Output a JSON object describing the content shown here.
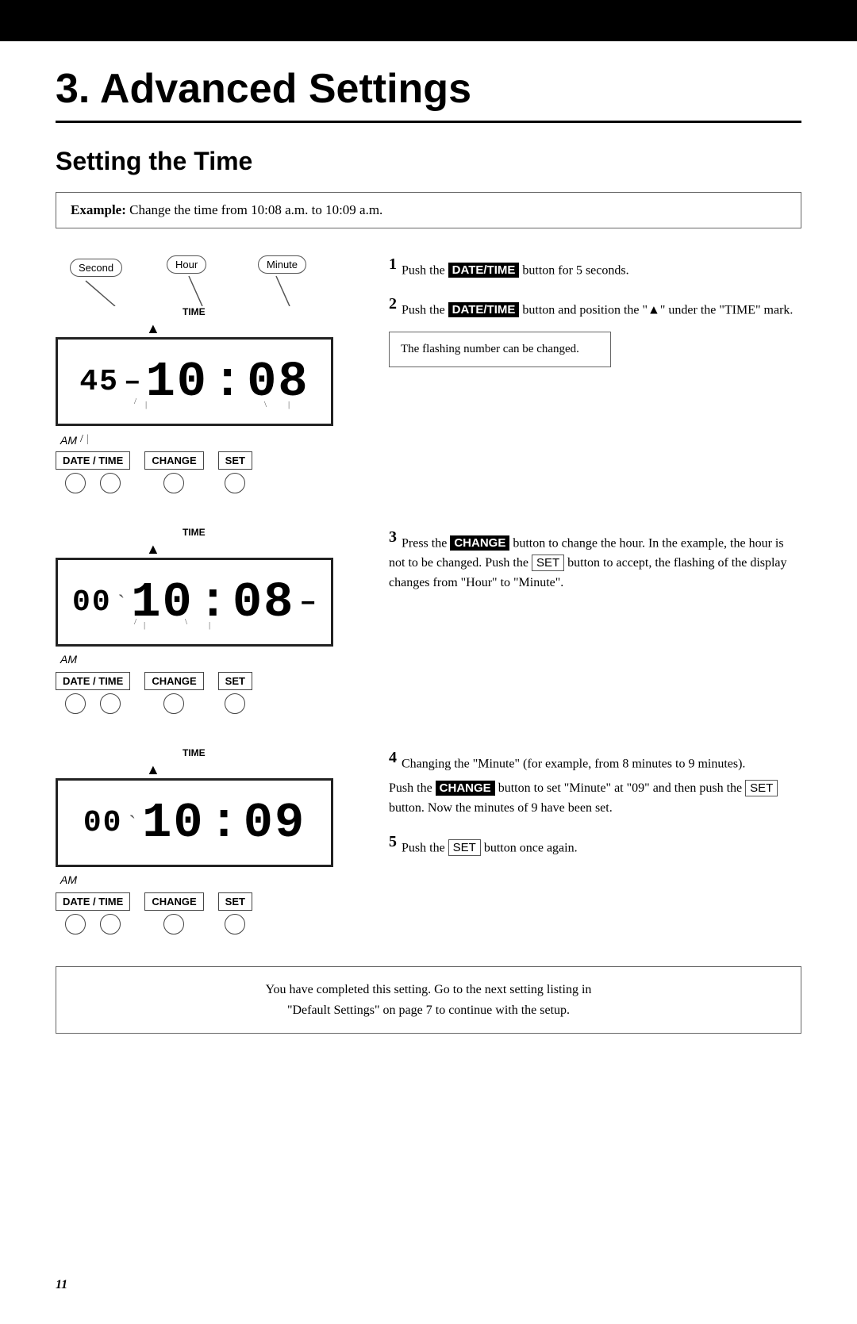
{
  "blackbar": "",
  "chapter": {
    "title": "3. Advanced Settings",
    "section": "Setting the Time",
    "example": {
      "label": "Example:",
      "text": "Change the time from 10:08 a.m. to 10:09 a.m."
    }
  },
  "clock1": {
    "time_label": "TIME",
    "seconds": "45",
    "dash": "–",
    "hours": "10",
    "colon": ":",
    "minutes": "08",
    "am": "AM",
    "slash": "/",
    "arrow_label": "▲",
    "balloons": {
      "second": "Second",
      "hour": "Hour",
      "minute": "Minute"
    },
    "buttons": {
      "date_time": "DATE / TIME",
      "change": "CHANGE",
      "set": "SET"
    }
  },
  "clock2": {
    "time_label": "TIME",
    "seconds": "00",
    "hours": "10",
    "colon": ":",
    "minutes": "08",
    "dash": "–",
    "am": "AM",
    "buttons": {
      "date_time": "DATE / TIME",
      "change": "CHANGE",
      "set": "SET"
    }
  },
  "clock3": {
    "time_label": "TIME",
    "seconds": "00",
    "hours": "10",
    "colon": ":",
    "minutes": "09",
    "am": "AM",
    "buttons": {
      "date_time": "DATE / TIME",
      "change": "CHANGE",
      "set": "SET"
    }
  },
  "steps": {
    "step1": {
      "num": "1",
      "text_before": "Push the ",
      "highlight": "DATE/TIME",
      "text_after": " button for 5 seconds."
    },
    "step2": {
      "num": "2",
      "text_before": "Push the ",
      "highlight": "DATE/TIME",
      "text_after": " button and position the \"▲\" under the \"TIME\" mark.",
      "note": "The flashing number can be changed."
    },
    "step3": {
      "num": "3",
      "text_before": "Press the ",
      "highlight": "CHANGE",
      "text_after1": " button to change the hour.  In the example, the hour is not to be changed. Push the ",
      "highlight2": "SET",
      "text_after2": " button to accept, the flashing of the display changes from \"Hour\" to \"Minute\"."
    },
    "step4": {
      "num": "4",
      "text_part1": "Changing the \"Minute\" (for example, from 8 minutes to 9 minutes).",
      "text_before2": "Push the ",
      "highlight": "CHANGE",
      "text_after2": " button to set \"Minute\" at \"09\" and then push the ",
      "highlight2": "SET",
      "text_after3": " button. Now the minutes of 9 have been set."
    },
    "step5": {
      "num": "5",
      "text_before": "Push the ",
      "highlight": "SET",
      "text_after": " button once again."
    }
  },
  "footer": {
    "line1": "You have completed this setting.  Go to the next setting listing in",
    "line2": "\"Default Settings\" on page 7 to continue with the setup."
  },
  "page_num": "11"
}
